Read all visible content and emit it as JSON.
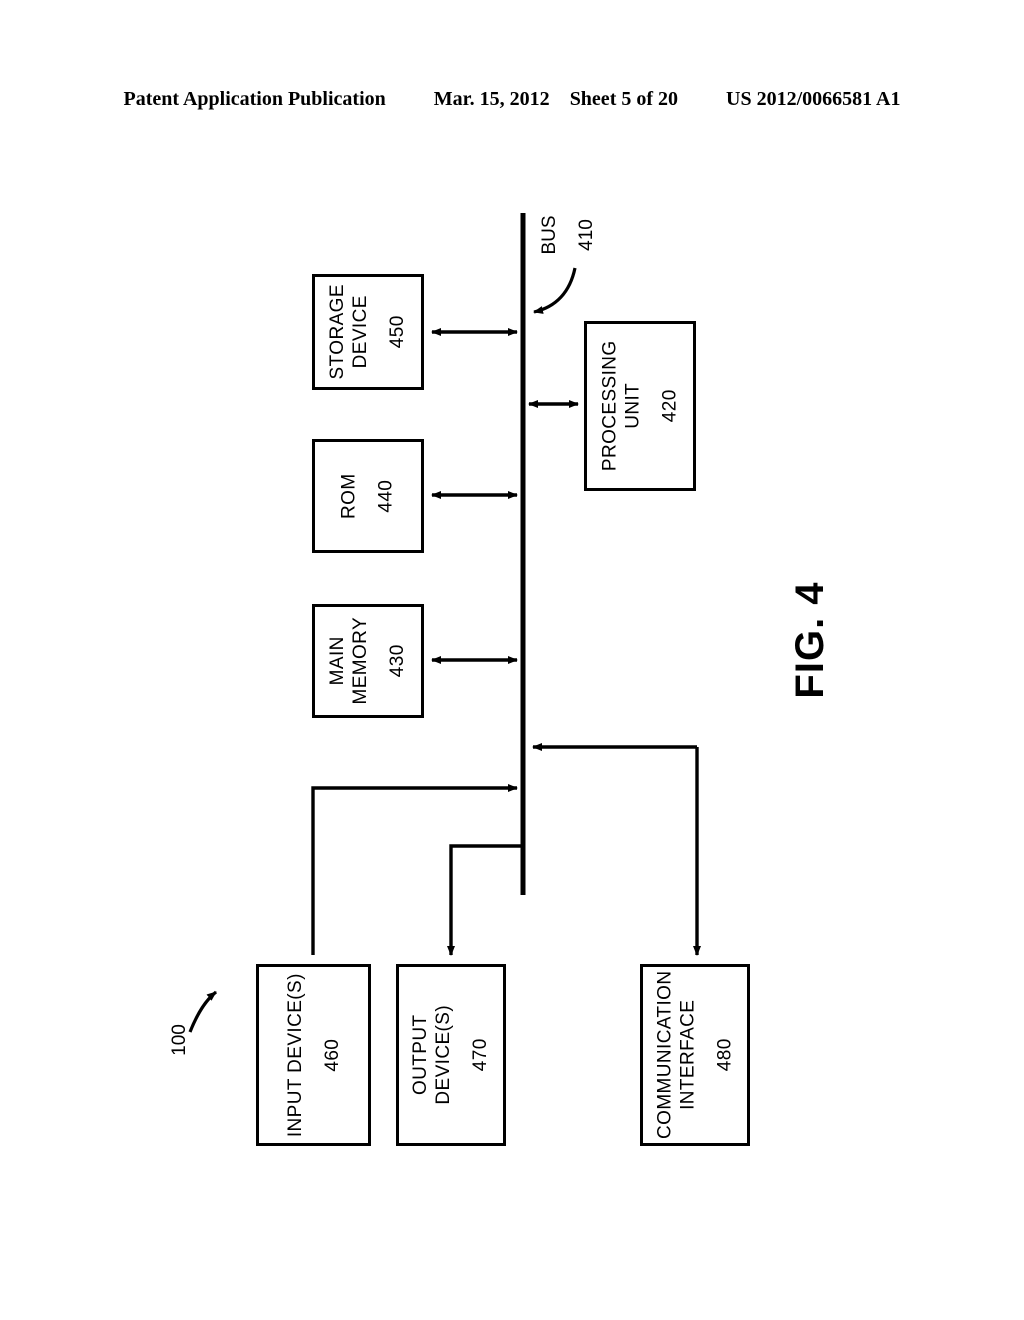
{
  "header": {
    "publication": "Patent Application Publication",
    "date": "Mar. 15, 2012",
    "sheet": "Sheet 5 of 20",
    "docket": "US 2012/0066581 A1"
  },
  "figure": {
    "caption": "FIG. 4",
    "system_reference": "100",
    "bus": {
      "label": "BUS",
      "number": "410"
    },
    "blocks": [
      {
        "id": "storage-device",
        "label": "STORAGE\nDEVICE",
        "line1": "STORAGE",
        "line2": "DEVICE",
        "number": "450"
      },
      {
        "id": "rom",
        "label": "ROM",
        "line1": "ROM",
        "line2": "",
        "number": "440"
      },
      {
        "id": "main-memory",
        "label": "MAIN\nMEMORY",
        "line1": "MAIN",
        "line2": "MEMORY",
        "number": "430"
      },
      {
        "id": "processing-unit",
        "label": "PROCESSING\nUNIT",
        "line1": "PROCESSING",
        "line2": "UNIT",
        "number": "420"
      },
      {
        "id": "input-devices",
        "label": "INPUT DEVICE(S)",
        "line1": "INPUT DEVICE(S)",
        "line2": "",
        "number": "460"
      },
      {
        "id": "output-devices",
        "label": "OUTPUT\nDEVICE(S)",
        "line1": "OUTPUT",
        "line2": "DEVICE(S)",
        "number": "470"
      },
      {
        "id": "communication-interface",
        "label": "COMMUNICATION\nINTERFACE",
        "line1": "COMMUNICATION",
        "line2": "INTERFACE",
        "number": "480"
      }
    ],
    "connections": [
      {
        "from": "storage-device",
        "to": "bus",
        "direction": "bidirectional"
      },
      {
        "from": "rom",
        "to": "bus",
        "direction": "bidirectional"
      },
      {
        "from": "main-memory",
        "to": "bus",
        "direction": "bidirectional"
      },
      {
        "from": "bus",
        "to": "processing-unit",
        "direction": "bidirectional"
      },
      {
        "from": "input-devices",
        "to": "bus",
        "direction": "to-bus"
      },
      {
        "from": "bus",
        "to": "output-devices",
        "direction": "from-bus"
      },
      {
        "from": "communication-interface",
        "to": "bus",
        "direction": "bidirectional-split"
      }
    ]
  },
  "colors": {
    "ink": "#000000",
    "paper": "#ffffff"
  }
}
